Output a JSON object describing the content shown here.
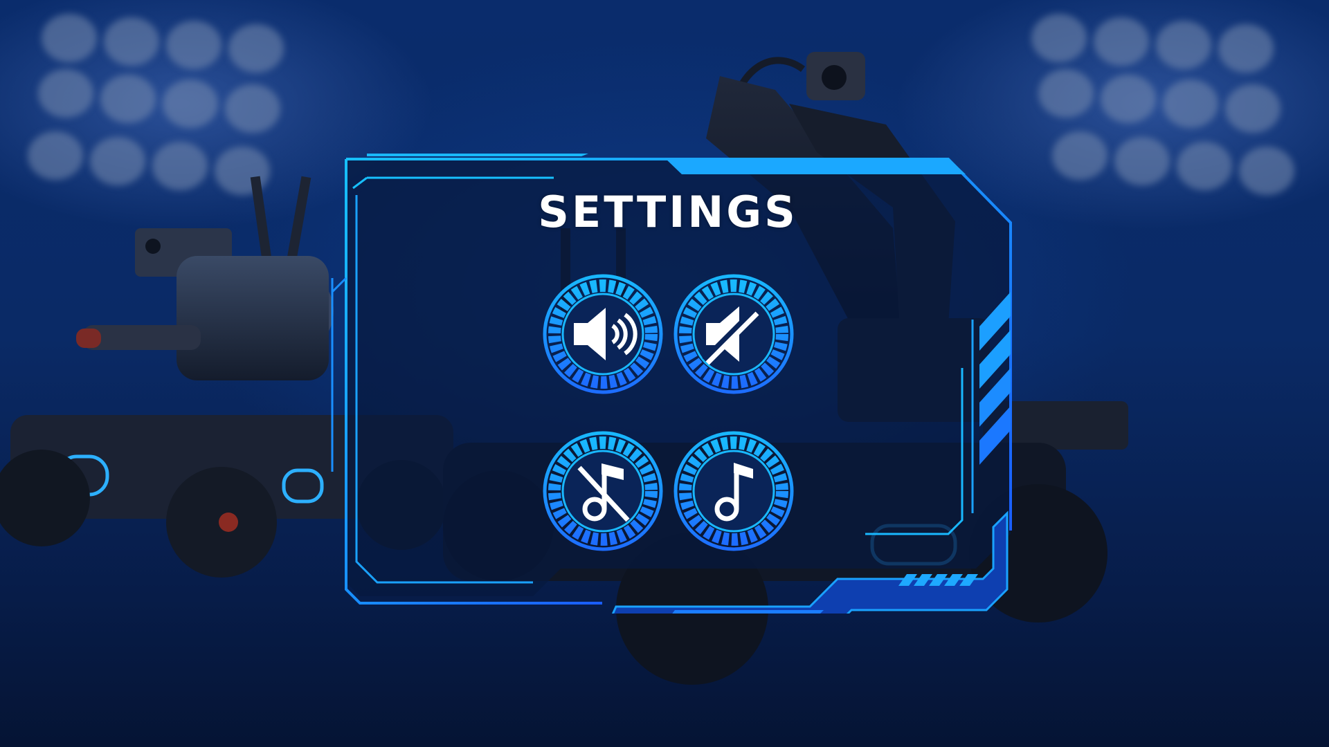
{
  "screen": {
    "title": "SETTINGS"
  },
  "buttons": [
    {
      "id": "sound-on",
      "icon": "speaker-on-icon"
    },
    {
      "id": "sound-off",
      "icon": "speaker-muted-icon"
    },
    {
      "id": "music-off",
      "icon": "music-off-icon"
    },
    {
      "id": "music-on",
      "icon": "music-note-icon"
    }
  ],
  "colors": {
    "frame_cyan": "#19b8ff",
    "frame_blue": "#1d6dff",
    "panel_fill": "#07193f",
    "icon_white": "#ffffff",
    "button_inner": "#0a2458"
  }
}
